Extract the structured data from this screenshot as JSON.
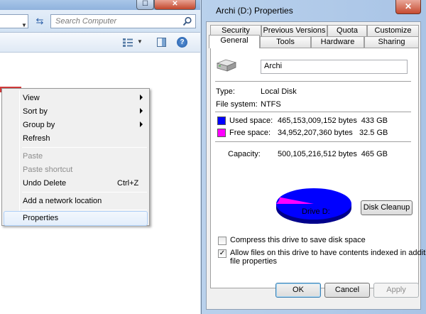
{
  "explorer": {
    "search_placeholder": "Search Computer",
    "maximize_glyph": "☐",
    "close_glyph": "✕",
    "help_glyph": "?"
  },
  "context_menu": {
    "items": [
      {
        "label": "View",
        "submenu": true,
        "enabled": true
      },
      {
        "label": "Sort by",
        "submenu": true,
        "enabled": true
      },
      {
        "label": "Group by",
        "submenu": true,
        "enabled": true
      },
      {
        "label": "Refresh",
        "enabled": true
      },
      {
        "label": "Paste",
        "enabled": false
      },
      {
        "label": "Paste shortcut",
        "enabled": false
      },
      {
        "label": "Undo Delete",
        "shortcut": "Ctrl+Z",
        "enabled": true
      },
      {
        "label": "Add a network location",
        "enabled": true
      },
      {
        "label": "Properties",
        "enabled": true,
        "highlighted": true
      }
    ]
  },
  "properties": {
    "title": "Archi (D:) Properties",
    "close_glyph": "✕",
    "tabs_row1": [
      "Security",
      "Previous Versions",
      "Quota",
      "Customize"
    ],
    "tabs_row2": [
      "General",
      "Tools",
      "Hardware",
      "Sharing"
    ],
    "active_tab": "General",
    "drive_label": "Archi",
    "type_label": "Type:",
    "type_value": "Local Disk",
    "fs_label": "File system:",
    "fs_value": "NTFS",
    "used_label": "Used space:",
    "used_bytes": "465,153,009,152 bytes",
    "used_size": "433 GB",
    "free_label": "Free space:",
    "free_bytes": "34,952,207,360 bytes",
    "free_size": "32.5 GB",
    "capacity_label": "Capacity:",
    "capacity_bytes": "500,105,216,512 bytes",
    "capacity_size": "465 GB",
    "drive_caption": "Drive D:",
    "disk_cleanup": "Disk Cleanup",
    "compress_label": "Compress this drive to save disk space",
    "compress_checked": false,
    "index_label_line1": "Allow files on this drive to have contents indexed in addition to",
    "index_label_line2": "file properties",
    "index_checked": true,
    "ok": "OK",
    "cancel": "Cancel",
    "apply": "Apply",
    "used_color": "#0000ff",
    "free_color": "#ff00ff",
    "used_fraction": 0.93
  }
}
